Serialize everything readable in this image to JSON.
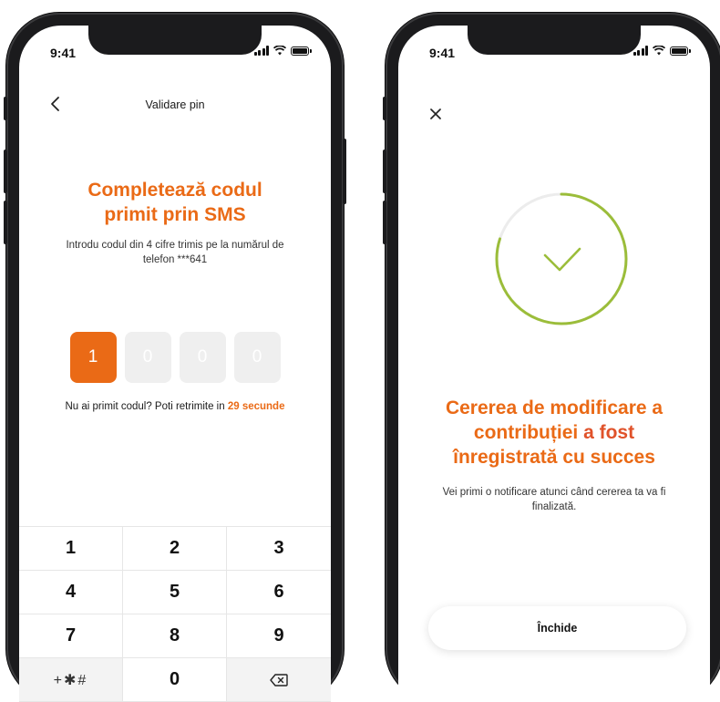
{
  "colors": {
    "accent": "#ea6a16",
    "accent_red": "#e0522a",
    "success_ring": "#9bbd3a"
  },
  "left_screen": {
    "status_time": "9:41",
    "nav_title": "Validare pin",
    "headline_line1": "Completează codul",
    "headline_line2": "primit prin SMS",
    "subtext_line1": "Introdu codul din 4 cifre trimis pe la numărul de",
    "subtext_line2": "telefon ***641",
    "pin_digits": [
      "1",
      "0",
      "0",
      "0"
    ],
    "resend_prefix": "Nu ai primit codul? Poti retrimite in",
    "resend_countdown": "29 secunde",
    "keypad": {
      "k1": "1",
      "k2": "2",
      "k3": "3",
      "k4": "4",
      "k5": "5",
      "k6": "6",
      "k7": "7",
      "k8": "8",
      "k9": "9",
      "symbols": "+✱#",
      "k0": "0"
    }
  },
  "right_screen": {
    "status_time": "9:41",
    "title_part1": "Cererea de modificare a",
    "title_part2a": "contribuției",
    "title_part2b": "a fost",
    "title_part3": "înregistrată cu succes",
    "sub_line1": "Vei primi o notificare atunci când cererea ta va fi",
    "sub_line2": "finalizată.",
    "progress": 0.8,
    "close_button_label": "Închide"
  }
}
